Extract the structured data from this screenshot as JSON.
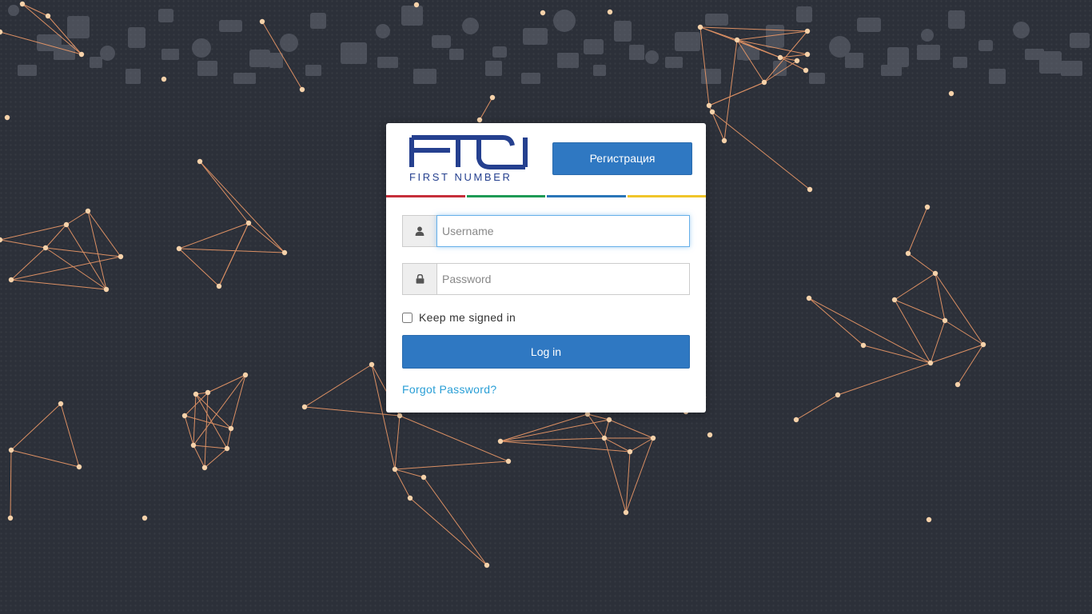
{
  "brand": {
    "name": "FIRST NUMBER",
    "color": "#25408f"
  },
  "header": {
    "register_label": "Регистрация"
  },
  "color_bar": [
    "#c62f3b",
    "#1e9a55",
    "#2a76b8",
    "#f0c52a"
  ],
  "form": {
    "username": {
      "placeholder": "Username",
      "value": "",
      "icon": "user-icon"
    },
    "password": {
      "placeholder": "Password",
      "value": "",
      "icon": "lock-icon"
    },
    "remember_label": "Keep me signed in",
    "remember_checked": false,
    "login_label": "Log in",
    "forgot_label": "Forgot Password?"
  },
  "theme": {
    "background": "#2c3039",
    "accent": "#2f78c2",
    "link": "#2a9fd6",
    "network_line": "#ee9a68",
    "network_node": "#f6d2aa"
  }
}
